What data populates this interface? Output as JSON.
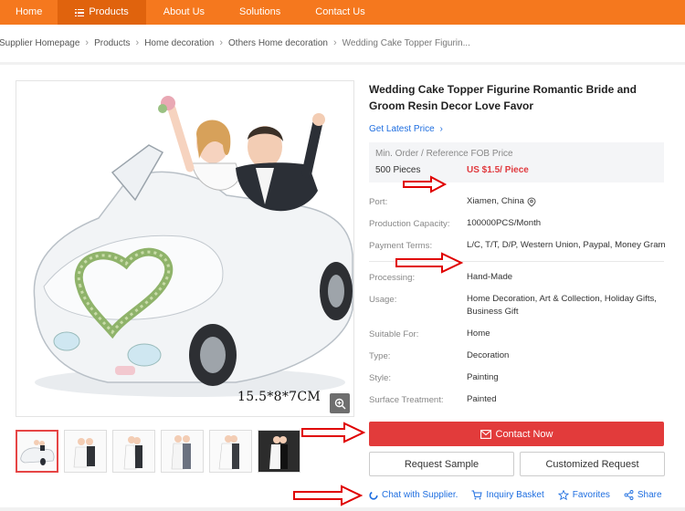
{
  "nav": {
    "items": [
      {
        "label": "Home"
      },
      {
        "label": "Products",
        "icon": "menu-icon"
      },
      {
        "label": "About Us"
      },
      {
        "label": "Solutions"
      },
      {
        "label": "Contact Us"
      }
    ]
  },
  "breadcrumb": {
    "items": [
      "Supplier Homepage",
      "Products",
      "Home decoration",
      "Others Home decoration"
    ],
    "current": "Wedding Cake Topper Figurin..."
  },
  "product": {
    "title": "Wedding Cake Topper Figurine Romantic Bride and Groom Resin Decor Love Favor",
    "latest_price_link": "Get Latest Price",
    "price_header": "Min. Order / Reference FOB Price",
    "min_order": "500 Pieces",
    "price": "US $1.5/ Piece",
    "image_size_label": "15.5*8*7CM",
    "attributes": {
      "port_label": "Port:",
      "port_value": "Xiamen, China",
      "capacity_label": "Production Capacity:",
      "capacity_value": "100000PCS/Month",
      "payment_label": "Payment Terms:",
      "payment_value": "L/C, T/T, D/P, Western Union, Paypal, Money Gram",
      "processing_label": "Processing:",
      "processing_value": "Hand-Made",
      "usage_label": "Usage:",
      "usage_value": "Home Decoration, Art & Collection, Holiday Gifts, Business Gift",
      "suitable_label": "Suitable For:",
      "suitable_value": "Home",
      "type_label": "Type:",
      "type_value": "Decoration",
      "style_label": "Style:",
      "style_value": "Painting",
      "surface_label": "Surface Treatment:",
      "surface_value": "Painted"
    }
  },
  "actions": {
    "contact_now": "Contact Now",
    "request_sample": "Request Sample",
    "customized_request": "Customized Request",
    "chat": "Chat with Supplier.",
    "inquiry_basket": "Inquiry Basket",
    "favorites": "Favorites",
    "share": "Share"
  },
  "colors": {
    "nav_bg": "#f5781e",
    "nav_active": "#e0630d",
    "primary_red": "#e23b3b",
    "price_red": "#e0393e",
    "link_blue": "#1e6ee0",
    "annotation_arrow": "#e00000"
  }
}
